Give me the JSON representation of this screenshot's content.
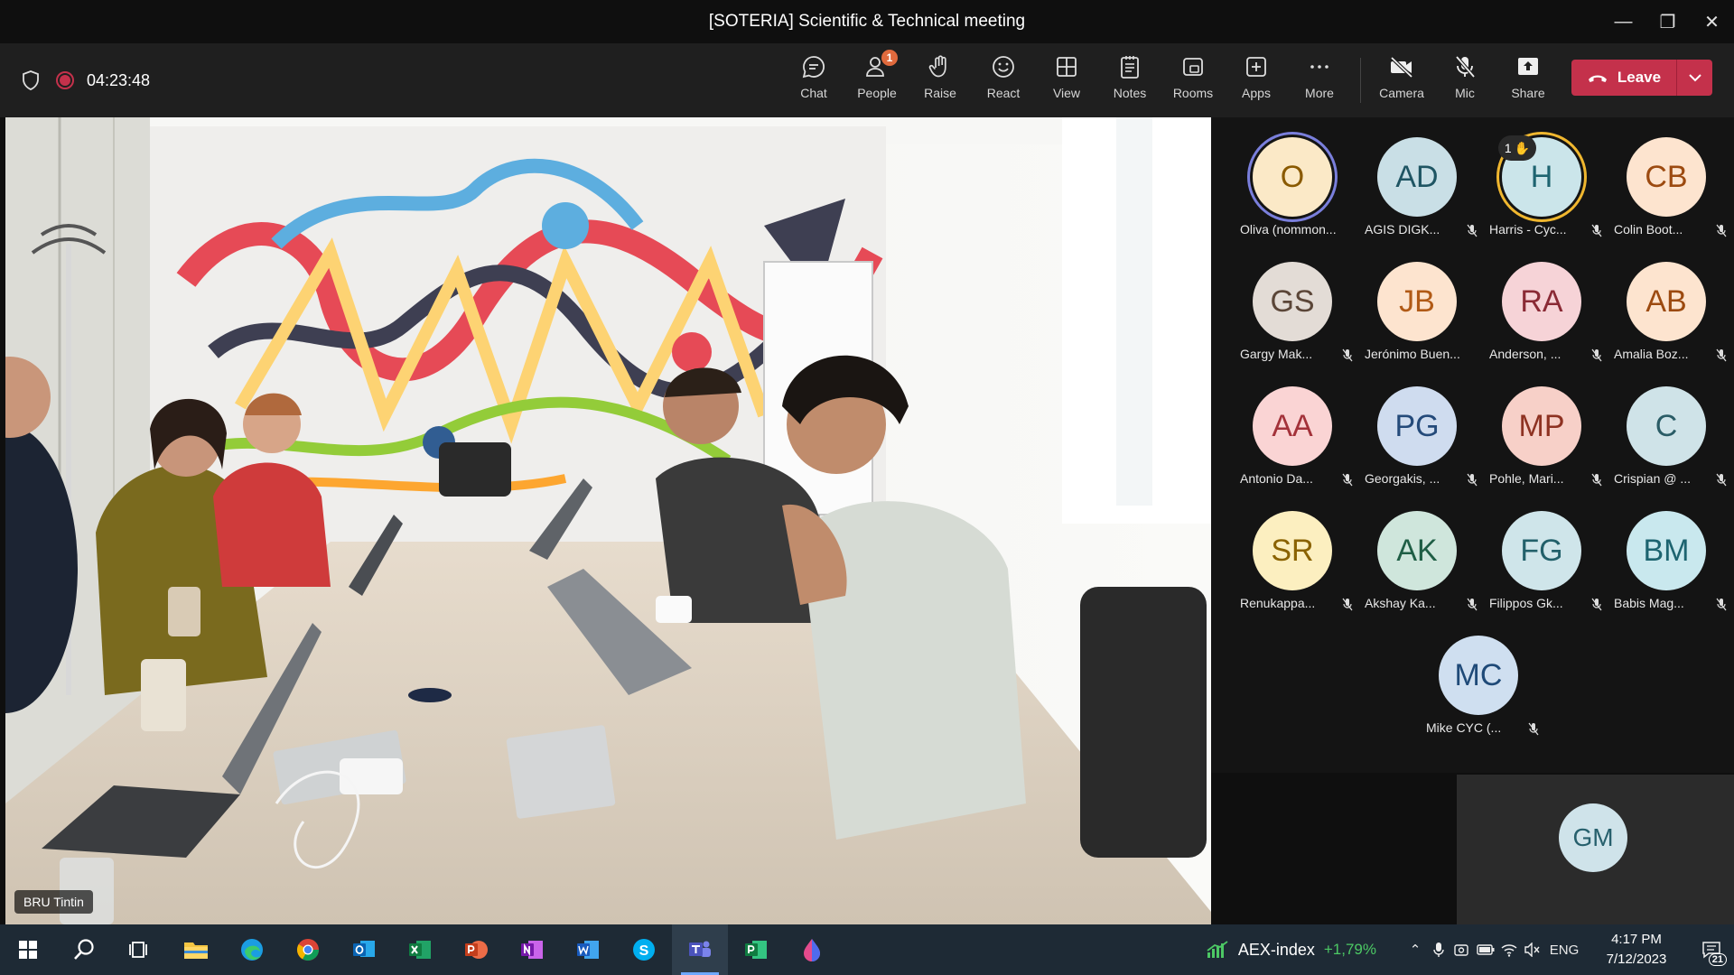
{
  "window": {
    "title": "[SOTERIA] Scientific & Technical meeting",
    "controls": [
      "minimize",
      "restore",
      "close"
    ]
  },
  "toolbar": {
    "timer": "04:23:48",
    "buttons": [
      {
        "label": "Chat",
        "icon": "chat-icon"
      },
      {
        "label": "People",
        "icon": "people-icon",
        "badge": "1"
      },
      {
        "label": "Raise",
        "icon": "raise-hand-icon"
      },
      {
        "label": "React",
        "icon": "react-icon"
      },
      {
        "label": "View",
        "icon": "view-grid-icon"
      },
      {
        "label": "Notes",
        "icon": "notes-icon"
      },
      {
        "label": "Rooms",
        "icon": "rooms-icon"
      },
      {
        "label": "Apps",
        "icon": "apps-icon"
      },
      {
        "label": "More",
        "icon": "more-icon"
      },
      {
        "label": "Camera",
        "icon": "camera-off-icon"
      },
      {
        "label": "Mic",
        "icon": "mic-off-icon"
      },
      {
        "label": "Share",
        "icon": "share-icon"
      }
    ],
    "leave_label": "Leave",
    "leave_color": "#c4314b"
  },
  "stage": {
    "speaker_name": "BRU Tintin"
  },
  "participants": [
    {
      "initials": "O",
      "name": "Oliva (nommon...",
      "bg": "#fbe9c7",
      "fg": "#8a5a00",
      "ring": "speaking",
      "muted": false
    },
    {
      "initials": "AD",
      "name": "AGIS DIGK...",
      "bg": "#c9dfe6",
      "fg": "#1f5563",
      "muted": true
    },
    {
      "initials": "H",
      "name": "Harris - Cyc...",
      "bg": "#cbe5ea",
      "fg": "#1e6470",
      "ring": "hand",
      "hand_count": "1",
      "muted": true
    },
    {
      "initials": "CB",
      "name": "Colin Boot...",
      "bg": "#fde4cf",
      "fg": "#9c4a10",
      "muted": true
    },
    {
      "initials": "GS",
      "name": "Gargy Mak...",
      "bg": "#e3dcd6",
      "fg": "#5b4638",
      "muted": true
    },
    {
      "initials": "JB",
      "name": "Jerónimo Buen...",
      "bg": "#fde4cf",
      "fg": "#b15a16",
      "muted": true
    },
    {
      "initials": "RA",
      "name": "Anderson, ...",
      "bg": "#f6d3d7",
      "fg": "#8a2a35",
      "muted": true
    },
    {
      "initials": "AB",
      "name": "Amalia Boz...",
      "bg": "#fde4cf",
      "fg": "#9c4a10",
      "muted": true
    },
    {
      "initials": "AA",
      "name": "Antonio Da...",
      "bg": "#fad4d4",
      "fg": "#a3323a",
      "muted": true
    },
    {
      "initials": "PG",
      "name": "Georgakis, ...",
      "bg": "#cfdcef",
      "fg": "#244a7a",
      "muted": true
    },
    {
      "initials": "MP",
      "name": "Pohle, Mari...",
      "bg": "#f7d0c8",
      "fg": "#8e3222",
      "muted": true
    },
    {
      "initials": "C",
      "name": "Crispian @ ...",
      "bg": "#cfe3e8",
      "fg": "#2a5c66",
      "muted": true
    },
    {
      "initials": "SR",
      "name": "Renukappa...",
      "bg": "#fcefc0",
      "fg": "#8a6200",
      "muted": true
    },
    {
      "initials": "AK",
      "name": "Akshay Ka...",
      "bg": "#cfe6dc",
      "fg": "#1f5e45",
      "muted": true
    },
    {
      "initials": "FG",
      "name": "Filippos Gk...",
      "bg": "#cfe5ea",
      "fg": "#22606a",
      "muted": true
    },
    {
      "initials": "BM",
      "name": "Babis Mag...",
      "bg": "#c9e8ee",
      "fg": "#1d6470",
      "muted": true
    },
    {
      "initials": "MC",
      "name": "Mike CYC (...",
      "bg": "#cfdff0",
      "fg": "#1f4a78",
      "muted": true
    }
  ],
  "self_view": {
    "initials": "GM",
    "bg": "#cfe3ea",
    "fg": "#27606d"
  },
  "taskbar": {
    "apps": [
      "start-icon",
      "search-icon",
      "task-view-icon",
      "file-explorer-icon",
      "edge-icon",
      "chrome-icon",
      "outlook-icon",
      "excel-icon",
      "powerpoint-icon",
      "onenote-icon",
      "word-icon",
      "skype-icon",
      "teams-icon",
      "project-icon",
      "paint-icon"
    ],
    "active_app": "teams-icon",
    "ticker_name": "AEX-index",
    "ticker_change": "+1,79%",
    "language": "ENG",
    "time": "4:17 PM",
    "date": "7/12/2023",
    "notification_count": "21"
  }
}
